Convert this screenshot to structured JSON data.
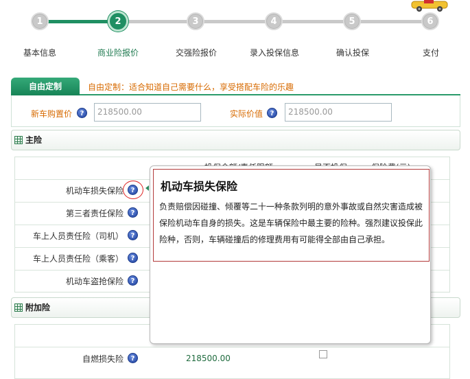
{
  "steps": [
    {
      "num": "1",
      "label": "基本信息"
    },
    {
      "num": "2",
      "label": "商业险报价"
    },
    {
      "num": "3",
      "label": "交强险报价"
    },
    {
      "num": "4",
      "label": "录入投保信息"
    },
    {
      "num": "5",
      "label": "确认投保"
    },
    {
      "num": "6",
      "label": "支付"
    }
  ],
  "colors": {
    "accent_green": "#1f8f62",
    "orange_text": "#d76a00",
    "tooltip_border": "#b23a3a"
  },
  "tab": {
    "label": "自由定制",
    "description": "自由定制：适合知道自己需要什么，享受搭配车险的乐趣"
  },
  "price": {
    "new_car_label": "新车购置价",
    "new_car_value": "218500.00",
    "actual_label": "实际价值",
    "actual_value": "218500.00"
  },
  "main_section": {
    "title": "主险",
    "columns": [
      "投保金额/责任限额",
      "是否投保",
      "保险费(元)"
    ],
    "rows": [
      "机动车损失保险",
      "第三者责任保险",
      "车上人员责任险（司机）",
      "车上人员责任险（乘客）",
      "机动车盗抢保险"
    ]
  },
  "addon_section": {
    "title": "附加险",
    "rows": [
      {
        "label": "自燃损失险",
        "amount": "218500.00"
      }
    ]
  },
  "tooltip": {
    "title": "机动车损失保险",
    "body": "负责赔偿因碰撞、倾覆等二十一种条款列明的意外事故或自然灾害造成被保险机动车自身的损失。这是车辆保险中最主要的险种。强烈建议投保此险种，否则，车辆碰撞后的修理费用有可能得全部由自己承担。"
  },
  "icons": {
    "help": "question-icon",
    "section": "grid-icon",
    "car": "car-icon"
  }
}
